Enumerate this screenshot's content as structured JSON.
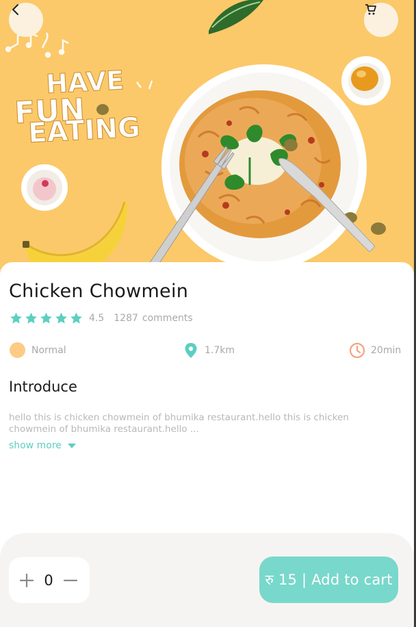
{
  "header": {
    "back_icon": "chevron-left-icon",
    "cart_icon": "cart-icon"
  },
  "hero": {
    "banner_lines": [
      "HAVE",
      "FUN",
      "EATING"
    ]
  },
  "product": {
    "name": "Chicken Chowmein",
    "rating": "4.5",
    "rating_stars": 5,
    "comments_count": "1287",
    "comments_label": "comments",
    "spice_level": "Normal",
    "distance": "1.7km",
    "time": "20min"
  },
  "introduce": {
    "title": "Introduce",
    "description": "hello this is chicken chowmein of bhumika restaurant.hello this is chicken chowmein of bhumika restaurant.hello ...",
    "show_more": "show more"
  },
  "cart_bar": {
    "quantity": "0",
    "add_label": "रु 15 | Add to cart"
  },
  "colors": {
    "accent": "#78D8CB",
    "accent_dark": "#5ccfc0",
    "star": "#5ccfc0",
    "hero_bg": "#FBC96A",
    "normal_dot": "#FDCB85",
    "clock": "#F6A17E"
  }
}
